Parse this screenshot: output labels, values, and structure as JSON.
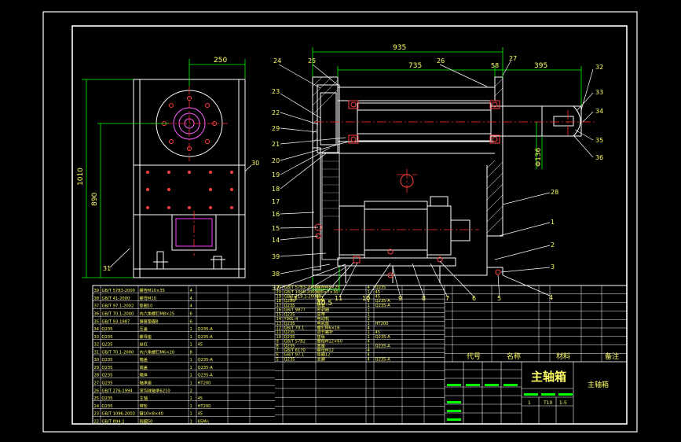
{
  "colors": {
    "background": "#000000",
    "frame": "#ffffff",
    "dimension": "#00ff00",
    "dimension_text": "#ffff66",
    "center_line": "#ff3030",
    "part_outline": "#ffffff",
    "hidden": "#ff00ff",
    "table_text": "#ffff66",
    "table_green": "#00ff00",
    "bolt": "#ff4040"
  },
  "title_block": {
    "drawing_name": "主轴箱",
    "drawing_name_small": "主轴箱",
    "col_code": "代号",
    "col_name": "名称",
    "col_material": "材料",
    "col_remark": "备注",
    "scale": "1:5",
    "material_tag": "T10",
    "sheet": "1"
  },
  "dimensions": {
    "top_total": "935",
    "top_left": "735",
    "top_gap": "58",
    "top_right": "395",
    "left_width": "250",
    "left_height_outer": "1010",
    "left_height_inner": "890",
    "shaft_dia": "Φ136",
    "bottom_offset": "40.5"
  },
  "balloons": {
    "left_view": [
      "31",
      "30"
    ],
    "main_top": [
      "24",
      "25",
      "26",
      "27"
    ],
    "main_left": [
      "23",
      "22",
      "29",
      "21",
      "20",
      "19",
      "18",
      "17",
      "16",
      "15",
      "14",
      "39",
      "38",
      "37"
    ],
    "main_right": [
      "32",
      "33",
      "34",
      "35",
      "36",
      "28",
      "1",
      "2",
      "3",
      "4"
    ],
    "main_bottom": [
      "13",
      "12",
      "11",
      "10",
      "9",
      "8",
      "7",
      "6",
      "5"
    ]
  },
  "parts_left": [
    [
      "39",
      "GB/T 5783-2000",
      "螺栓M10×35",
      "4",
      "",
      "",
      ""
    ],
    [
      "38",
      "GB/T 41-2000",
      "螺母M10",
      "4",
      "",
      "",
      ""
    ],
    [
      "37",
      "GB/T 97.1-2002",
      "垫圈10",
      "4",
      "",
      "",
      ""
    ],
    [
      "36",
      "GB/T 70.1-2000",
      "内六角螺钉M8×25",
      "6",
      "",
      "",
      ""
    ],
    [
      "35",
      "GB/T 93-1987",
      "弹簧垫圈8",
      "6",
      "",
      "",
      ""
    ],
    [
      "34",
      "Q235",
      "压盖",
      "1",
      "Q235-A",
      "",
      ""
    ],
    [
      "33",
      "Q235",
      "螺母座",
      "1",
      "Q235-A",
      "",
      ""
    ],
    [
      "32",
      "Q235",
      "丝杠",
      "1",
      "45",
      "",
      ""
    ],
    [
      "31",
      "GB/T 70.1-2000",
      "内六角螺钉M6×20",
      "8",
      "",
      "",
      ""
    ],
    [
      "30",
      "Q235",
      "箱盖",
      "1",
      "Q235-A",
      "",
      ""
    ],
    [
      "29",
      "Q235",
      "端盖",
      "1",
      "Q235-A",
      "",
      ""
    ],
    [
      "28",
      "Q235",
      "箱体",
      "1",
      "Q235-A",
      "",
      ""
    ],
    [
      "27",
      "Q235",
      "轴承座",
      "1",
      "HT200",
      "",
      ""
    ],
    [
      "26",
      "GB/T 276-1994",
      "深沟球轴承6210",
      "2",
      "",
      "",
      ""
    ],
    [
      "25",
      "Q235",
      "主轴",
      "1",
      "45",
      "",
      ""
    ],
    [
      "24",
      "Q235",
      "带轮",
      "1",
      "HT200",
      "",
      ""
    ],
    [
      "23",
      "GB/T 1096-2003",
      "键10×8×40",
      "1",
      "45",
      "",
      ""
    ],
    [
      "22",
      "GB/T 894.1",
      "挡圈50",
      "1",
      "65Mn",
      "",
      ""
    ]
  ],
  "parts_right": [
    [
      "21",
      "GB/T 5783-2000",
      "螺栓M8×25",
      "4",
      "Q235",
      "",
      ""
    ],
    [
      "20",
      "GB/T 1096-2003",
      "键8×7×30",
      "1",
      "45",
      "",
      ""
    ],
    [
      "19",
      "GB/T 119.1-2000",
      "销",
      "2",
      "45",
      "",
      ""
    ],
    [
      "18",
      "Q235",
      "套筒",
      "1",
      "Q235-A",
      "",
      ""
    ],
    [
      "17",
      "Q235",
      "隔套",
      "1",
      "Q235-A",
      "",
      ""
    ],
    [
      "16",
      "GB/T 9877",
      "密封圈",
      "1",
      "",
      "",
      ""
    ],
    [
      "15",
      "Q235",
      "皮带",
      "1",
      "",
      "",
      ""
    ],
    [
      "14",
      "Y90L-4",
      "电动机",
      "1",
      "",
      "",
      ""
    ],
    [
      "13",
      "Q235",
      "电机座",
      "1",
      "HT200",
      "",
      ""
    ],
    [
      "12",
      "GB/T 70.1",
      "螺钉M6×16",
      "4",
      "",
      "",
      ""
    ],
    [
      "11",
      "Q235",
      "调节螺杆",
      "1",
      "45",
      "",
      ""
    ],
    [
      "10",
      "Q235",
      "垫板",
      "1",
      "Q235-A",
      "",
      ""
    ],
    [
      "9",
      "GB/T 5782",
      "螺栓M12×60",
      "4",
      "",
      "",
      ""
    ],
    [
      "8",
      "Q235",
      "底座",
      "1",
      "Q235-A",
      "",
      ""
    ],
    [
      "7",
      "GB/T 6170",
      "螺母M12",
      "4",
      "",
      "",
      ""
    ],
    [
      "6",
      "GB/T 97.1",
      "垫圈12",
      "4",
      "",
      "",
      ""
    ],
    [
      "5",
      "Q235",
      "支脚",
      "4",
      "Q235-A",
      "",
      ""
    ]
  ]
}
